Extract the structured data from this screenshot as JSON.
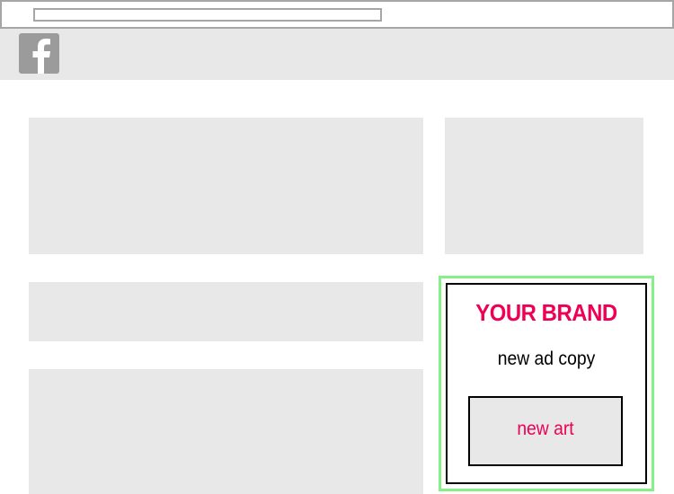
{
  "browser": {
    "address_value": ""
  },
  "header": {
    "logo_icon": "facebook-f-icon",
    "logo_color": "#9b9b9b"
  },
  "ad": {
    "brand_label": "YOUR BRAND",
    "copy_text": "new ad copy",
    "art_label": "new art",
    "accent_color": "#ee0055",
    "highlight_border_color": "#88ee88"
  },
  "colors": {
    "placeholder_fill": "#e8e8e8",
    "browser_border": "#a6a6a6"
  }
}
